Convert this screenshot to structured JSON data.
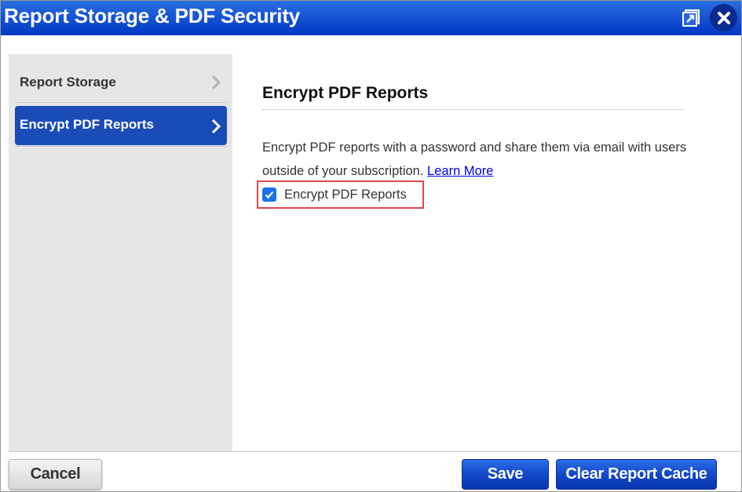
{
  "dialog": {
    "title": "Report Storage & PDF Security",
    "icons": {
      "popout": "popout-icon",
      "close": "close-icon"
    }
  },
  "sidebar": {
    "items": [
      {
        "label": "Report Storage",
        "active": false,
        "icon": "chevron-right-icon"
      },
      {
        "label": "Encrypt PDF Reports",
        "active": true,
        "icon": "chevron-right-icon"
      }
    ]
  },
  "main": {
    "heading": "Encrypt PDF Reports",
    "description": "Encrypt PDF reports with a password and share them via email with users outside of your subscription.",
    "learn_more_label": "Learn More",
    "checkbox": {
      "label": "Encrypt PDF Reports",
      "checked": true,
      "highlight_color": "#e0474c"
    }
  },
  "footer": {
    "cancel_label": "Cancel",
    "save_label": "Save",
    "clear_cache_label": "Clear Report Cache"
  },
  "colors": {
    "titlebar": "#1450d0",
    "active_nav": "#1a4cb8",
    "button_blue": "#1248c8",
    "checkbox": "#1a73e8"
  }
}
